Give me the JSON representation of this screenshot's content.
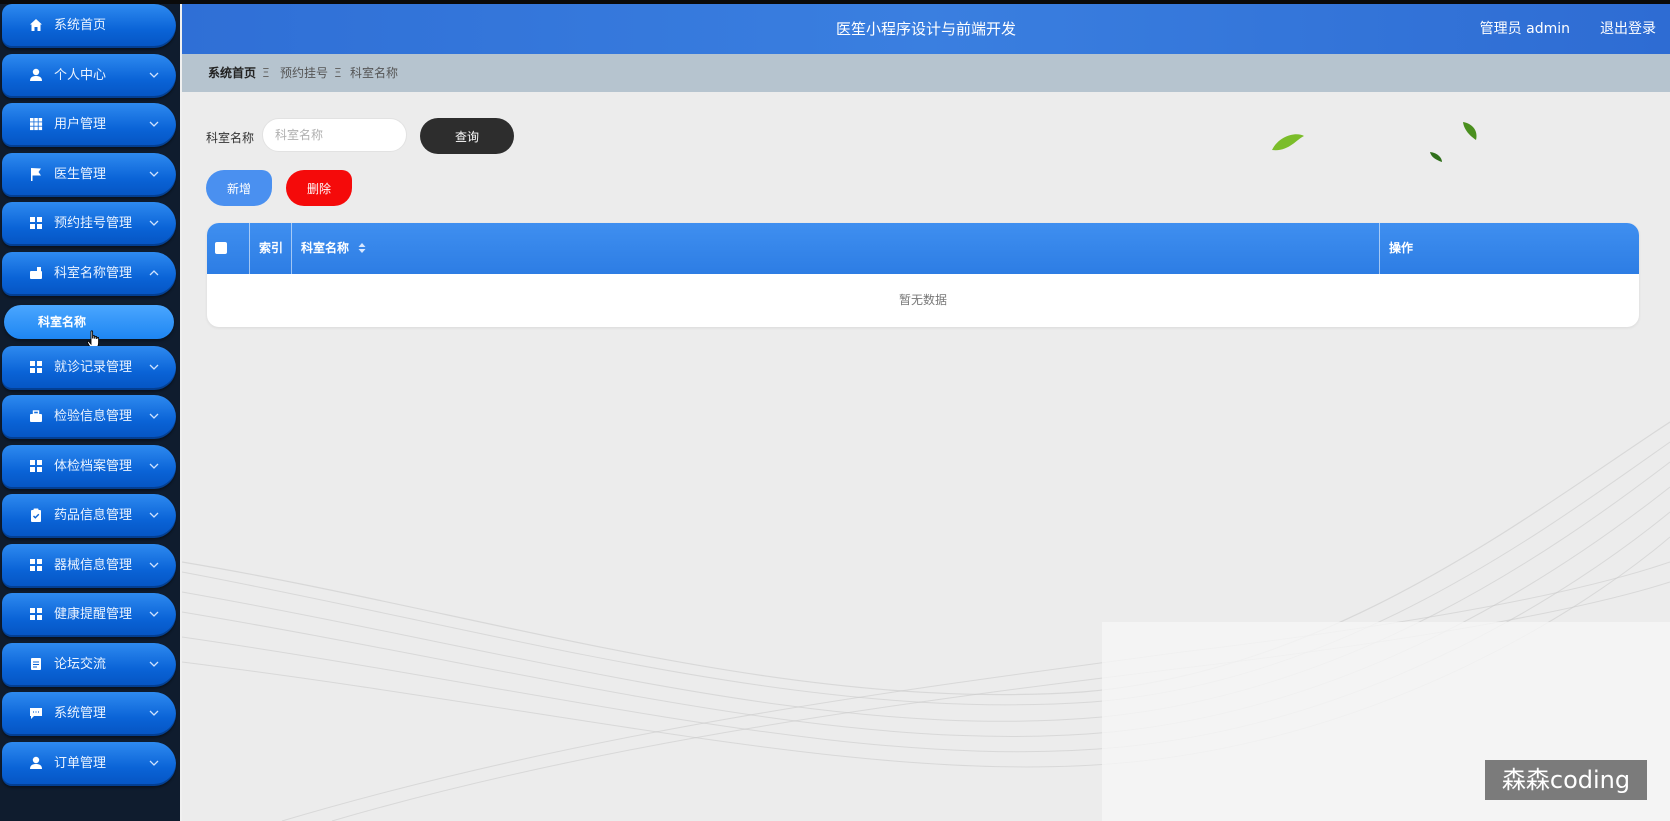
{
  "header": {
    "app_title": "医笙小程序设计与前端开发",
    "user_label": "管理员 admin",
    "logout_label": "退出登录"
  },
  "sidebar": {
    "items": [
      {
        "label": "系统首页",
        "icon": "home-icon",
        "has_chevron": false
      },
      {
        "label": "个人中心",
        "icon": "user-icon",
        "has_chevron": true
      },
      {
        "label": "用户管理",
        "icon": "grid-icon",
        "has_chevron": true
      },
      {
        "label": "医生管理",
        "icon": "flag-icon",
        "has_chevron": true
      },
      {
        "label": "预约挂号管理",
        "icon": "apps-icon",
        "has_chevron": true
      },
      {
        "label": "科室名称管理",
        "icon": "briefcase-icon",
        "has_chevron": true,
        "expanded": true
      },
      {
        "label": "就诊记录管理",
        "icon": "apps-icon",
        "has_chevron": true
      },
      {
        "label": "检验信息管理",
        "icon": "toolbox-icon",
        "has_chevron": true
      },
      {
        "label": "体检档案管理",
        "icon": "apps-icon",
        "has_chevron": true
      },
      {
        "label": "药品信息管理",
        "icon": "clipboard-icon",
        "has_chevron": true
      },
      {
        "label": "器械信息管理",
        "icon": "apps-icon",
        "has_chevron": true
      },
      {
        "label": "健康提醒管理",
        "icon": "apps-icon",
        "has_chevron": true
      },
      {
        "label": "论坛交流",
        "icon": "document-icon",
        "has_chevron": true
      },
      {
        "label": "系统管理",
        "icon": "chat-icon",
        "has_chevron": true
      },
      {
        "label": "订单管理",
        "icon": "user-icon",
        "has_chevron": true
      }
    ],
    "active_sub_item": "科室名称"
  },
  "breadcrumb": [
    "系统首页",
    "预约挂号",
    "科室名称"
  ],
  "breadcrumb_separator": "Ξ",
  "search": {
    "label": "科室名称",
    "placeholder": "科室名称",
    "value": "",
    "query_label": "查询"
  },
  "actions": {
    "add_label": "新增",
    "delete_label": "删除"
  },
  "table": {
    "columns": [
      "索引",
      "科室名称",
      "操作"
    ],
    "rows": [],
    "empty_text": "暂无数据"
  },
  "watermark": "森森coding",
  "colors": {
    "sidebar_item": "#0a63d6",
    "header": "#3a7fe0",
    "breadcrumb_bar": "#b6c4cf",
    "table_header": "#3f8ff0",
    "query_button": "#2d2d2d",
    "add_button": "#4a90f0",
    "delete_button": "#f50a0a"
  }
}
